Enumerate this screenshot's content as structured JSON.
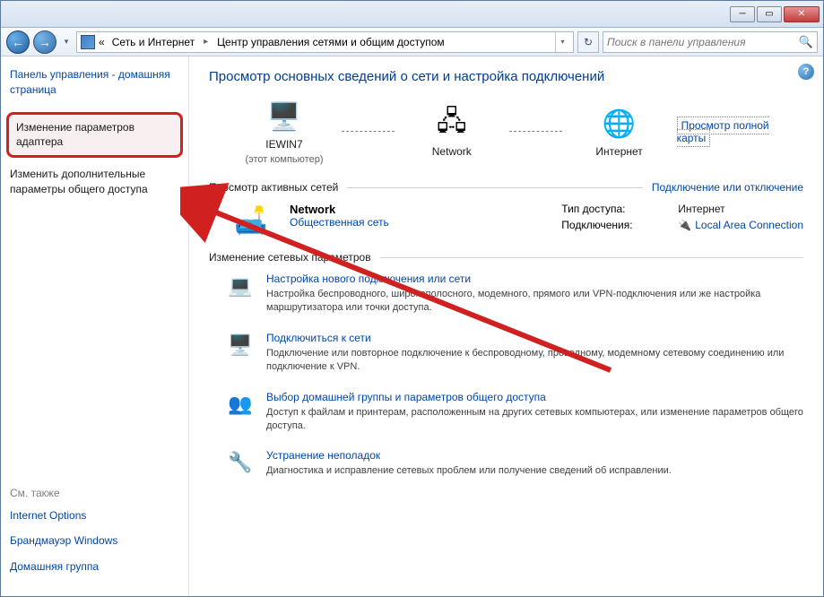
{
  "breadcrumb": {
    "prefix": "«",
    "parts": [
      "Сеть и Интернет",
      "Центр управления сетями и общим доступом"
    ]
  },
  "search": {
    "placeholder": "Поиск в панели управления"
  },
  "sidebar": {
    "home": "Панель управления - домашняя страница",
    "adapter": "Изменение параметров адаптера",
    "sharing": "Изменить дополнительные параметры общего доступа",
    "see_also": "См. также",
    "links": [
      "Internet Options",
      "Брандмауэр Windows",
      "Домашняя группа"
    ]
  },
  "main": {
    "title": "Просмотр основных сведений о сети и настройка подключений",
    "map": {
      "node1": "IEWIN7",
      "node1_sub": "(этот компьютер)",
      "node2": "Network",
      "node3": "Интернет",
      "fullmap": "Просмотр полной карты"
    },
    "active_header": "Просмотр активных сетей",
    "active_right": "Подключение или отключение",
    "network": {
      "name": "Network",
      "type": "Общественная сеть",
      "access_k": "Тип доступа:",
      "access_v": "Интернет",
      "conn_k": "Подключения:",
      "conn_v": "Local Area Connection"
    },
    "change_header": "Изменение сетевых параметров",
    "items": [
      {
        "title": "Настройка нового подключения или сети",
        "desc": "Настройка беспроводного, широкополосного, модемного, прямого или VPN-подключения или же настройка маршрутизатора или точки доступа."
      },
      {
        "title": "Подключиться к сети",
        "desc": "Подключение или повторное подключение к беспроводному, проводному, модемному сетевому соединению или подключение к VPN."
      },
      {
        "title": "Выбор домашней группы и параметров общего доступа",
        "desc": "Доступ к файлам и принтерам, расположенным на других сетевых компьютерах, или изменение параметров общего доступа."
      },
      {
        "title": "Устранение неполадок",
        "desc": "Диагностика и исправление сетевых проблем или получение сведений об исправлении."
      }
    ]
  }
}
